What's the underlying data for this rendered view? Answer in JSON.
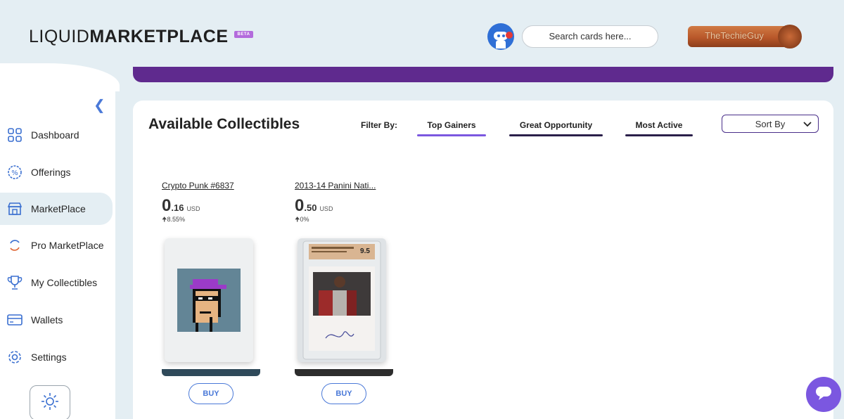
{
  "header": {
    "logo_light": "LIQUID",
    "logo_bold": "MARKETPLACE",
    "beta_badge": "BETA",
    "search_placeholder": "Search cards here...",
    "username": "TheTechieGuy"
  },
  "sidebar": {
    "collapse_icon": "chevron-left-icon",
    "items": [
      {
        "label": "Dashboard",
        "icon": "grid-icon"
      },
      {
        "label": "Offerings",
        "icon": "percent-badge-icon"
      },
      {
        "label": "MarketPlace",
        "icon": "store-icon",
        "active": true
      },
      {
        "label": "Pro MarketPlace",
        "icon": "refresh-icon"
      },
      {
        "label": "My Collectibles",
        "icon": "trophy-icon"
      },
      {
        "label": "Wallets",
        "icon": "wallet-icon"
      },
      {
        "label": "Settings",
        "icon": "gear-icon"
      }
    ],
    "theme_icon": "sun-icon"
  },
  "main": {
    "title": "Available Collectibles",
    "filter_label": "Filter By:",
    "filters": [
      {
        "label": "Top Gainers",
        "active": true
      },
      {
        "label": "Great Opportunity"
      },
      {
        "label": "Most Active"
      }
    ],
    "sort_label": "Sort By"
  },
  "cards": [
    {
      "name": "Crypto Punk #6837",
      "price_int": "0",
      "price_dec": ".16",
      "currency": "USD",
      "change": "8.55%",
      "buy_label": "BUY",
      "base_color": "#2f4a5a"
    },
    {
      "name": "2013-14 Panini Nati...",
      "price_int": "0",
      "price_dec": ".50",
      "currency": "USD",
      "change": "0%",
      "grade": "9.5",
      "buy_label": "BUY",
      "base_color": "#2d2d2d"
    }
  ],
  "colors": {
    "accent": "#7b57e0",
    "banner": "#5f2a8e",
    "link": "#4a79d8"
  }
}
